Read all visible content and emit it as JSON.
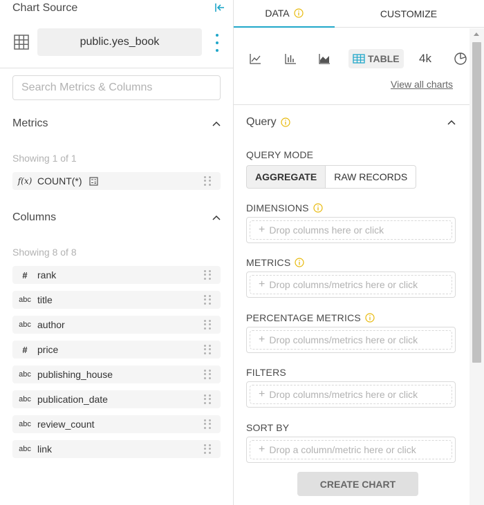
{
  "datasource": {
    "title": "Chart Source",
    "name": "public.yes_book",
    "search_placeholder": "Search Metrics & Columns"
  },
  "metrics": {
    "title": "Metrics",
    "showing": "Showing 1 of 1",
    "items": [
      {
        "type": "f(x)",
        "name": "COUNT(*)"
      }
    ]
  },
  "columns": {
    "title": "Columns",
    "showing": "Showing 8 of 8",
    "items": [
      {
        "type": "#",
        "name": "rank"
      },
      {
        "type": "abc",
        "name": "title"
      },
      {
        "type": "abc",
        "name": "author"
      },
      {
        "type": "#",
        "name": "price"
      },
      {
        "type": "abc",
        "name": "publishing_house"
      },
      {
        "type": "abc",
        "name": "publication_date"
      },
      {
        "type": "abc",
        "name": "review_count"
      },
      {
        "type": "abc",
        "name": "link"
      }
    ]
  },
  "tabs": {
    "data": "DATA",
    "customize": "CUSTOMIZE"
  },
  "viz": {
    "icons": [
      "line-chart-icon",
      "bar-chart-icon",
      "area-chart-icon",
      "table-icon",
      "big-number-icon",
      "pie-chart-icon"
    ],
    "table_label": "TABLE",
    "big_number_label": "4k",
    "view_all": "View all charts"
  },
  "query": {
    "title": "Query",
    "mode_label": "QUERY MODE",
    "mode_aggregate": "AGGREGATE",
    "mode_raw": "RAW RECORDS",
    "dimensions_label": "DIMENSIONS",
    "dimensions_placeholder": "Drop columns here or click",
    "metrics_label": "METRICS",
    "metrics_placeholder": "Drop columns/metrics here or click",
    "percentage_label": "PERCENTAGE METRICS",
    "percentage_placeholder": "Drop columns/metrics here or click",
    "filters_label": "FILTERS",
    "filters_placeholder": "Drop columns/metrics here or click",
    "sortby_label": "SORT BY",
    "sortby_placeholder": "Drop a column/metric here or click"
  },
  "create_button": "CREATE CHART",
  "colors": {
    "accent": "#20a7c9",
    "info": "#e8b90a",
    "muted": "#b2b2b2"
  }
}
